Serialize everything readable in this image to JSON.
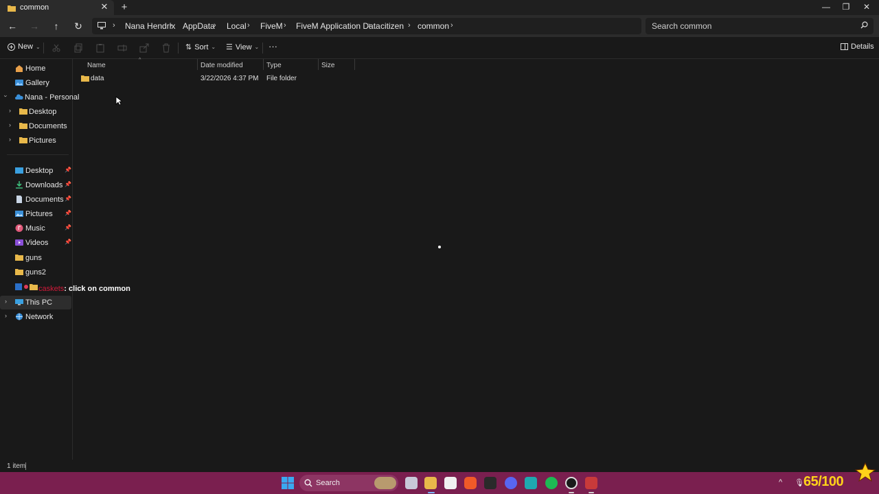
{
  "window": {
    "tab_title": "common",
    "tab_close": "✕",
    "new_tab": "+",
    "minimize": "—",
    "maximize": "❐",
    "close": "✕"
  },
  "nav": {
    "back": "←",
    "forward": "→",
    "up": "↑",
    "refresh": "↻"
  },
  "breadcrumbs": [
    "Nana Hendrix",
    "AppData",
    "Local",
    "FiveM",
    "FiveM Application Data",
    "citizen",
    "common"
  ],
  "search": {
    "placeholder": "Search common"
  },
  "commandbar": {
    "new_label": "New",
    "sort_label": "Sort",
    "view_label": "View",
    "more_label": "···",
    "details_label": "Details"
  },
  "sidebar": {
    "home": "Home",
    "gallery": "Gallery",
    "onedrive": "Nana - Personal",
    "od_desktop": "Desktop",
    "od_documents": "Documents",
    "od_pictures": "Pictures",
    "quick": [
      {
        "label": "Desktop",
        "pinned": true
      },
      {
        "label": "Downloads",
        "pinned": true
      },
      {
        "label": "Documents",
        "pinned": true
      },
      {
        "label": "Pictures",
        "pinned": true
      },
      {
        "label": "Music",
        "pinned": true
      },
      {
        "label": "Videos",
        "pinned": true
      },
      {
        "label": "guns",
        "pinned": false
      },
      {
        "label": "guns2",
        "pinned": false
      }
    ],
    "this_pc": "This PC",
    "network": "Network"
  },
  "overlay": {
    "username": "caskets",
    "message": ": click on common"
  },
  "columns": {
    "name": "Name",
    "date": "Date modified",
    "type": "Type",
    "size": "Size"
  },
  "files": [
    {
      "name": "data",
      "date": "3/22/2026 4:37 PM",
      "type": "File folder",
      "size": ""
    }
  ],
  "status": {
    "count": "1 item"
  },
  "taskbar": {
    "search_label": "Search",
    "progress": "65/100"
  },
  "colors": {
    "accent_folder": "#e8b84a",
    "taskbar": "#7a1f4f",
    "overlay_user": "#d11a3a",
    "progress": "#ffd21a"
  }
}
